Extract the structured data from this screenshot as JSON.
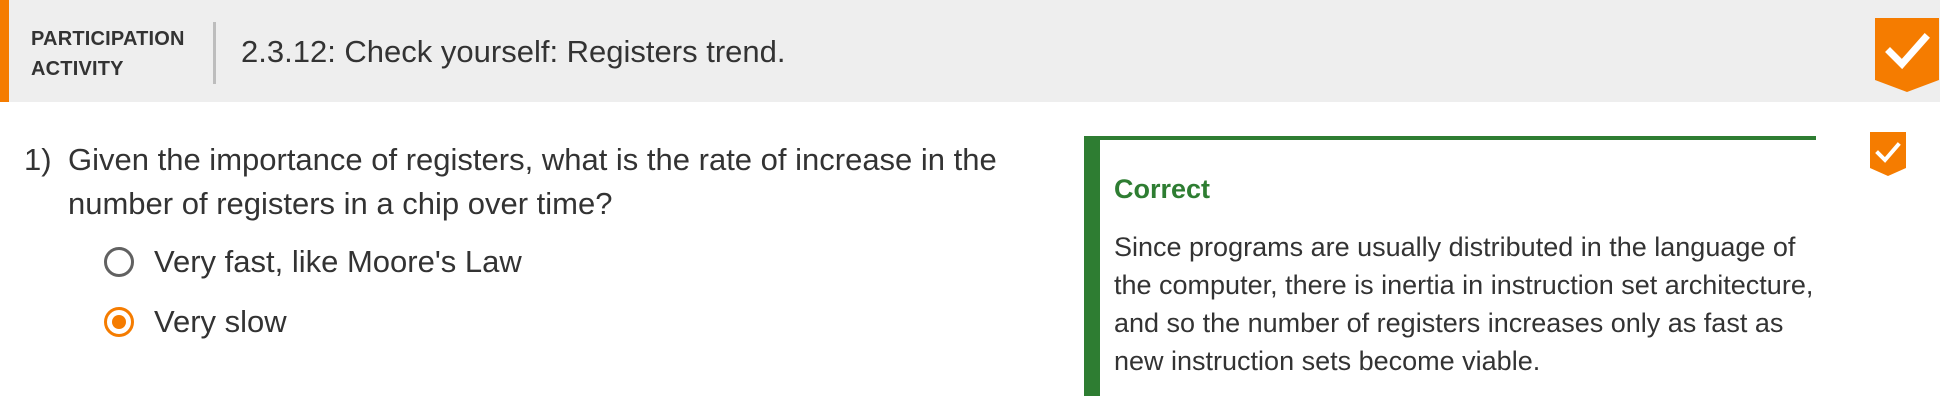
{
  "header": {
    "activity_type": "PARTICIPATION ACTIVITY",
    "title": "2.3.12: Check yourself: Registers trend.",
    "completion_icon": "checkmark-badge-icon",
    "accent_color": "#f57c00"
  },
  "question": {
    "number": "1)",
    "text": "Given the importance of registers, what is the rate of increase in the number of registers in a chip over time?",
    "choices": [
      {
        "label": "Very fast, like Moore's Law",
        "selected": false
      },
      {
        "label": "Very slow",
        "selected": true
      }
    ],
    "status_icon": "checkmark-badge-icon"
  },
  "feedback": {
    "title": "Correct",
    "text": "Since programs are usually distributed in the language of the computer, there is inertia in instruction set architecture, and so the number of registers increases only as fast as new instruction sets become viable.",
    "color": "#2e7d32"
  }
}
